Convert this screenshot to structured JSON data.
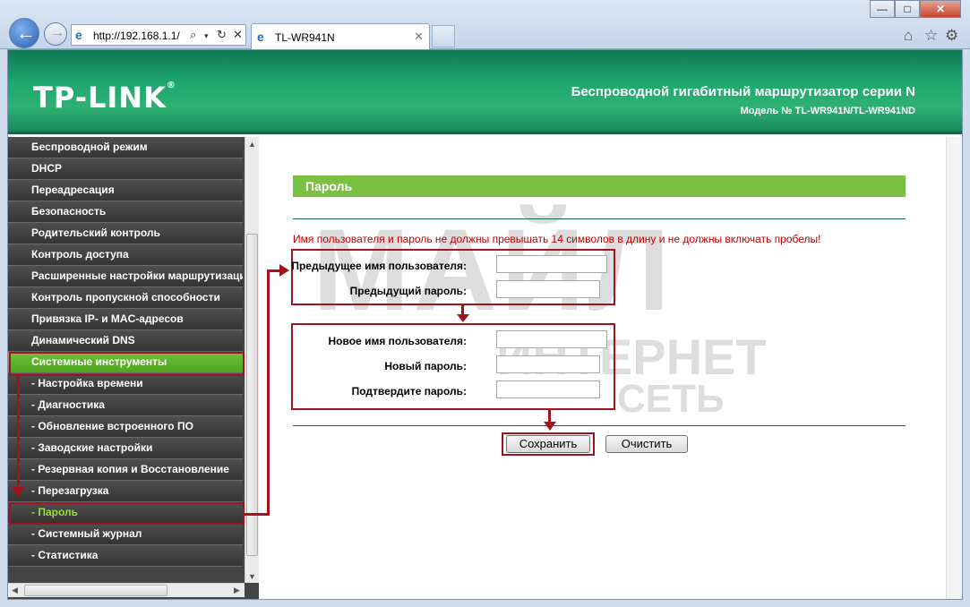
{
  "browser": {
    "address": "http://192.168.1.1/",
    "tab_title": "TL-WR941N",
    "window_buttons": {
      "minimize": "—",
      "maximize": "□",
      "close": "✕"
    }
  },
  "header": {
    "logo": "TP-LINK",
    "title": "Беспроводной гигабитный маршрутизатор серии N",
    "model": "Модель № TL-WR941N/TL-WR941ND"
  },
  "sidebar": {
    "items": [
      {
        "label": "Беспроводной режим"
      },
      {
        "label": "DHCP"
      },
      {
        "label": "Переадресация"
      },
      {
        "label": "Безопасность"
      },
      {
        "label": "Родительский контроль"
      },
      {
        "label": "Контроль доступа"
      },
      {
        "label": "Расширенные настройки маршрутизации"
      },
      {
        "label": "Контроль пропускной способности"
      },
      {
        "label": "Привязка IP- и MAC-адресов"
      },
      {
        "label": "Динамический DNS"
      },
      {
        "label": "Системные инструменты"
      },
      {
        "label": "- Настройка времени"
      },
      {
        "label": "- Диагностика"
      },
      {
        "label": "- Обновление встроенного ПО"
      },
      {
        "label": "- Заводские настройки"
      },
      {
        "label": "- Резервная копия и Восстановление"
      },
      {
        "label": "- Перезагрузка"
      },
      {
        "label": "- Пароль"
      },
      {
        "label": "- Системный журнал"
      },
      {
        "label": "- Статистика"
      }
    ]
  },
  "main": {
    "section_title": "Пароль",
    "warning": "Имя пользователя и пароль не должны превышать 14 символов в длину и не должны включать пробелы!",
    "fields": {
      "old_user": {
        "label": "Предыдущее имя пользователя:",
        "value": ""
      },
      "old_pass": {
        "label": "Предыдущий пароль:",
        "value": ""
      },
      "new_user": {
        "label": "Новое имя пользователя:",
        "value": ""
      },
      "new_pass": {
        "label": "Новый пароль:",
        "value": ""
      },
      "confirm_pass": {
        "label": "Подтвердите пароль:",
        "value": ""
      }
    },
    "save_label": "Сохранить",
    "clear_label": "Очистить"
  },
  "watermark": {
    "big": "МАЙЛ",
    "mid": "ИНТЕРНЕТ",
    "small": "СЕТЬ"
  },
  "colors": {
    "header_green": "#1ea76e",
    "accent_green": "#7ac143",
    "annotation_red": "#a0141e",
    "warning_red": "#c00000"
  }
}
